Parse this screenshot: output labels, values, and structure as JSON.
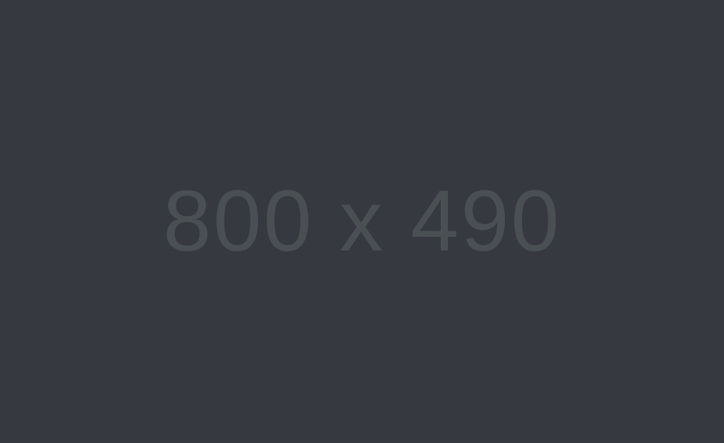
{
  "placeholder": {
    "label": "800 x 490",
    "background_color": "#363a40",
    "text_color": "#4a4f54"
  }
}
